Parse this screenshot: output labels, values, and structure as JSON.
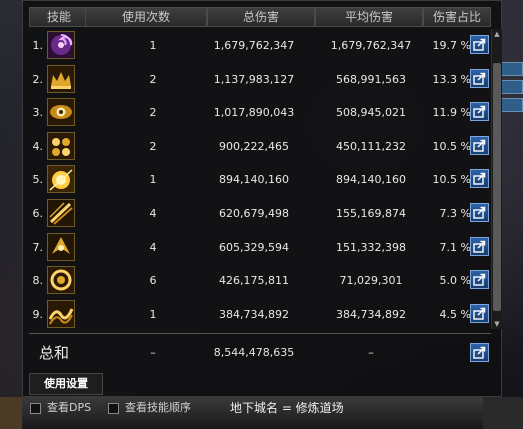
{
  "table": {
    "headers": [
      "技能",
      "使用次数",
      "总伤害",
      "平均伤害",
      "伤害占比"
    ],
    "rows": [
      {
        "rank": "1.",
        "icon": "skill-violet-vortex-icon",
        "uses": "1",
        "total": "1,679,762,347",
        "avg": "1,679,762,347",
        "pct": "19.7 %"
      },
      {
        "rank": "2.",
        "icon": "skill-golden-crown-icon",
        "uses": "2",
        "total": "1,137,983,127",
        "avg": "568,991,563",
        "pct": "13.3 %"
      },
      {
        "rank": "3.",
        "icon": "skill-golden-eye-icon",
        "uses": "2",
        "total": "1,017,890,043",
        "avg": "508,945,021",
        "pct": "11.9 %"
      },
      {
        "rank": "4.",
        "icon": "skill-golden-orbs-icon",
        "uses": "2",
        "total": "900,222,465",
        "avg": "450,111,232",
        "pct": "10.5 %"
      },
      {
        "rank": "5.",
        "icon": "skill-golden-burst-icon",
        "uses": "1",
        "total": "894,140,160",
        "avg": "894,140,160",
        "pct": "10.5 %"
      },
      {
        "rank": "6.",
        "icon": "skill-golden-slash-icon",
        "uses": "4",
        "total": "620,679,498",
        "avg": "155,169,874",
        "pct": "7.3 %"
      },
      {
        "rank": "7.",
        "icon": "skill-golden-strike-icon",
        "uses": "4",
        "total": "605,329,594",
        "avg": "151,332,398",
        "pct": "7.1 %"
      },
      {
        "rank": "8.",
        "icon": "skill-golden-ring-icon",
        "uses": "6",
        "total": "426,175,811",
        "avg": "71,029,301",
        "pct": "5.0 %"
      },
      {
        "rank": "9.",
        "icon": "skill-golden-wave-icon",
        "uses": "1",
        "total": "384,734,892",
        "avg": "384,734,892",
        "pct": "4.5 %"
      }
    ],
    "summary": {
      "label": "总和",
      "uses": "–",
      "total": "8,544,478,635",
      "avg": "–"
    }
  },
  "tabs": {
    "settings": "使用设置"
  },
  "bottom": {
    "dps_checkbox": "查看DPS",
    "order_checkbox": "查看技能顺序",
    "dungeon": "地下城名 = 修炼道场"
  },
  "colors": {
    "panel": "#101012",
    "share_button": "#2c62a8",
    "icon_gold": "#e0a82a",
    "icon_violet": "#8a3fa8"
  }
}
